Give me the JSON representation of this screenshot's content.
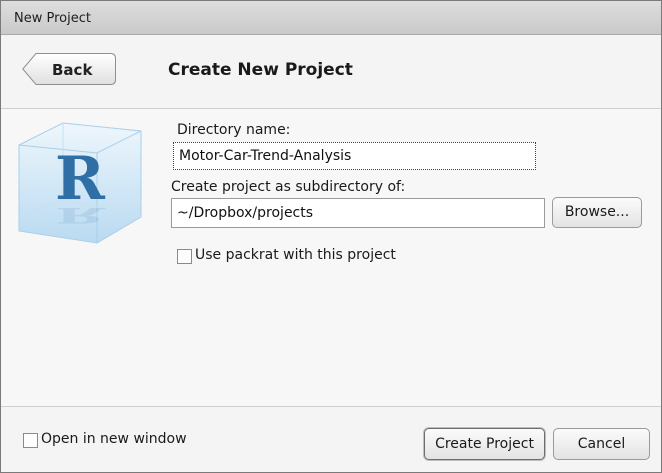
{
  "window": {
    "title": "New Project"
  },
  "header": {
    "back_label": "Back",
    "title": "Create New Project"
  },
  "form": {
    "directory_label": "Directory name:",
    "directory_value": "Motor-Car-Trend-Analysis",
    "subdirectory_label": "Create project as subdirectory of:",
    "subdirectory_value": "~/Dropbox/projects",
    "browse_label": "Browse...",
    "packrat_label": "Use packrat with this project",
    "packrat_checked": false
  },
  "footer": {
    "new_window_label": "Open in new window",
    "new_window_checked": false,
    "create_label": "Create Project",
    "cancel_label": "Cancel"
  },
  "logo": {
    "letter": "R"
  },
  "colors": {
    "logo_blue": "#2f6fa6",
    "cube_light": "#cfe6f6"
  }
}
